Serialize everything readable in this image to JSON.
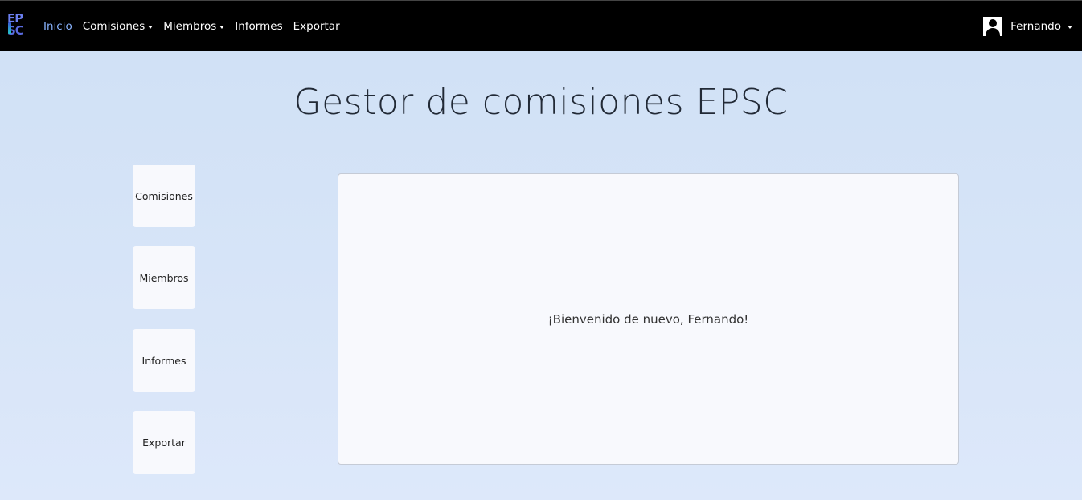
{
  "navbar": {
    "brand": {
      "line1": "EP",
      "line2": "SC"
    },
    "links": [
      {
        "label": "Inicio",
        "active": true,
        "dropdown": false
      },
      {
        "label": "Comisiones",
        "active": false,
        "dropdown": true
      },
      {
        "label": "Miembros",
        "active": false,
        "dropdown": true
      },
      {
        "label": "Informes",
        "active": false,
        "dropdown": false
      },
      {
        "label": "Exportar",
        "active": false,
        "dropdown": false
      }
    ],
    "user": {
      "name": "Fernando",
      "icon": "user-avatar-icon"
    }
  },
  "page": {
    "title": "Gestor de comisiones EPSC"
  },
  "side_menu": {
    "items": [
      {
        "label": "Comisiones"
      },
      {
        "label": "Miembros"
      },
      {
        "label": "Informes"
      },
      {
        "label": "Exportar"
      }
    ]
  },
  "main": {
    "welcome": "¡Bienvenido de nuevo, Fernando!"
  },
  "colors": {
    "navbar_bg": "#000000",
    "active_link": "#8ab4ff",
    "page_bg": "#d6e4f8",
    "card_bg": "#f8f9fd"
  }
}
